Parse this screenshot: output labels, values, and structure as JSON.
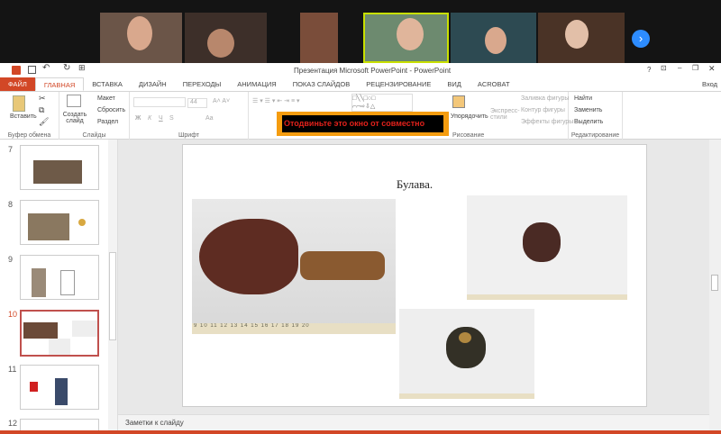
{
  "window": {
    "title": "Презентация Microsoft PowerPoint - PowerPoint",
    "help": "?",
    "signin": "Вход"
  },
  "tabs": [
    "ФАЙЛ",
    "ГЛАВНАЯ",
    "ВСТАВКА",
    "ДИЗАЙН",
    "ПЕРЕХОДЫ",
    "АНИМАЦИЯ",
    "ПОКАЗ СЛАЙДОВ",
    "РЕЦЕНЗИРОВАНИЕ",
    "ВИД",
    "ACROBAT"
  ],
  "ribbon": {
    "clipboard": {
      "paste": "Вставить",
      "label": "Буфер обмена"
    },
    "slides": {
      "new_slide": "Создать слайд",
      "layout": "Макет",
      "reset": "Сбросить",
      "section": "Раздел",
      "label": "Слайды"
    },
    "font": {
      "size": "44",
      "label": "Шрифт",
      "bold": "Ж",
      "italic": "К",
      "underline": "Ч",
      "strike": "S",
      "case": "Aa"
    },
    "drawing": {
      "arrange": "Упорядочить",
      "styles": "Экспресс-стили",
      "fill": "Заливка фигуры",
      "outline": "Контур фигуры",
      "effects": "Эффекты фигуры",
      "label": "Рисование"
    },
    "editing": {
      "find": "Найти",
      "replace": "Заменить",
      "select": "Выделить",
      "label": "Редактирование"
    }
  },
  "overlay": {
    "text": "Отодвиньте это окно от совместно"
  },
  "thumbnails": [
    {
      "num": "7"
    },
    {
      "num": "8"
    },
    {
      "num": "9"
    },
    {
      "num": "10"
    },
    {
      "num": "11"
    },
    {
      "num": "12"
    }
  ],
  "slide": {
    "title": "Булава.",
    "ruler1": "9 10 11 12 13 14 15 16 17 18 19 20"
  },
  "notes": "Заметки к слайду",
  "colors": {
    "accent": "#d24726",
    "banner": "#f59c0f"
  }
}
